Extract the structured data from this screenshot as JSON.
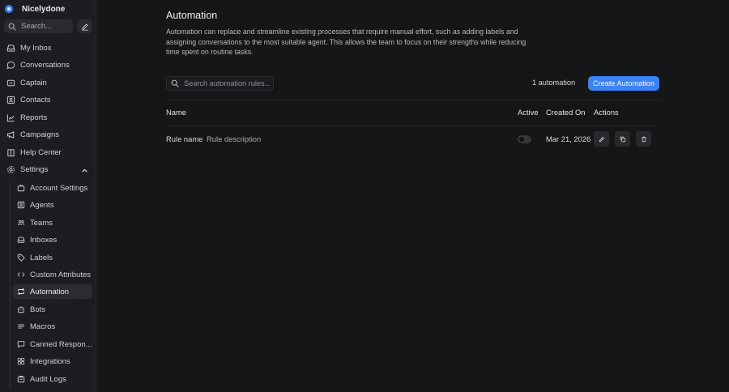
{
  "sidebar": {
    "brand": "Nicelydone",
    "search_placeholder": "Search...",
    "nav": [
      {
        "label": "My Inbox",
        "icon": "inbox-icon"
      },
      {
        "label": "Conversations",
        "icon": "chat-bubble-icon"
      },
      {
        "label": "Captain",
        "icon": "captain-icon"
      },
      {
        "label": "Contacts",
        "icon": "contact-card-icon"
      },
      {
        "label": "Reports",
        "icon": "chart-line-icon"
      },
      {
        "label": "Campaigns",
        "icon": "megaphone-icon"
      },
      {
        "label": "Help Center",
        "icon": "book-icon"
      },
      {
        "label": "Settings",
        "icon": "gear-icon"
      }
    ],
    "settings_items": [
      {
        "label": "Account Settings",
        "icon": "briefcase-icon"
      },
      {
        "label": "Agents",
        "icon": "agent-icon"
      },
      {
        "label": "Teams",
        "icon": "team-icon"
      },
      {
        "label": "Inboxes",
        "icon": "inbox-tray-icon"
      },
      {
        "label": "Labels",
        "icon": "tag-icon"
      },
      {
        "label": "Custom Attributes",
        "icon": "code-icon"
      },
      {
        "label": "Automation",
        "icon": "automation-icon",
        "active": true
      },
      {
        "label": "Bots",
        "icon": "bot-icon"
      },
      {
        "label": "Macros",
        "icon": "macro-icon"
      },
      {
        "label": "Canned Respon...",
        "icon": "canned-response-icon"
      },
      {
        "label": "Integrations",
        "icon": "integrations-icon"
      },
      {
        "label": "Audit Logs",
        "icon": "audit-icon"
      }
    ]
  },
  "main": {
    "title": "Automation",
    "description": "Automation can replace and streamline existing processes that require manual effort, such as adding labels and assigning conversations to the most suitable agent. This allows the team to focus on their strengths while reducing time spent on routine tasks.",
    "search_placeholder": "Search automation rules...",
    "count": "1 automation",
    "create_label": "Create Automation",
    "columns": {
      "name": "Name",
      "active": "Active",
      "created": "Created On",
      "actions": "Actions"
    },
    "rows": [
      {
        "name": "Rule name",
        "description": "Rule description",
        "active": false,
        "created": "Mar 21, 2026"
      }
    ]
  },
  "colors": {
    "accent": "#3b82f6",
    "background": "#151618",
    "sidebar": "#1c1d20"
  }
}
